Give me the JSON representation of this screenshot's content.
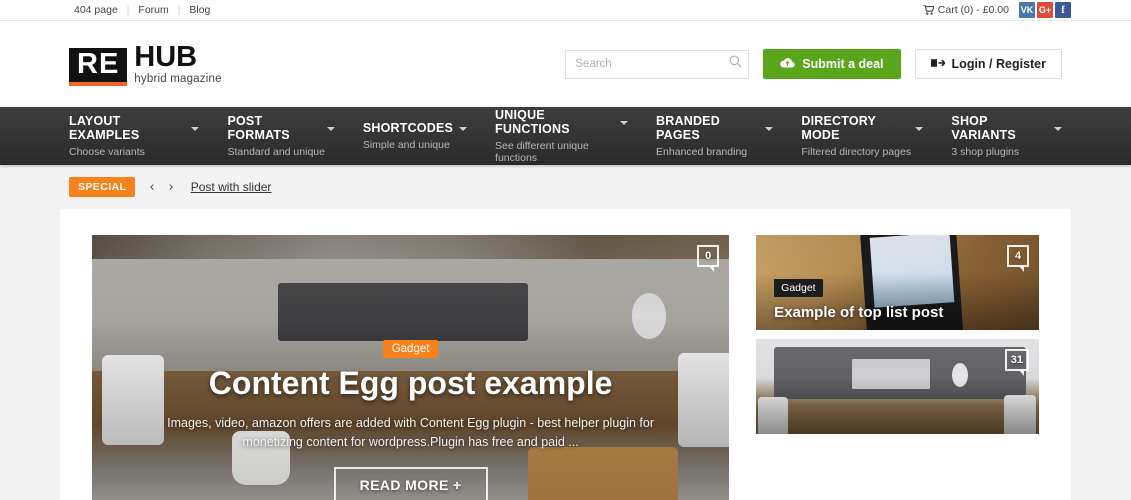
{
  "topbar": {
    "links": [
      {
        "label": "404 page"
      },
      {
        "label": "Forum"
      },
      {
        "label": "Blog"
      }
    ],
    "separator": "|",
    "cart_label": "Cart (0) - £0.00",
    "social": [
      {
        "name": "vk-icon",
        "label": "VK",
        "color": "#4a76a8"
      },
      {
        "name": "googleplus-icon",
        "label": "G+",
        "color": "#dd4b39"
      },
      {
        "name": "facebook-icon",
        "label": "f",
        "color": "#3b5998"
      }
    ]
  },
  "header": {
    "logo_mark": "RE",
    "logo_name": "HUB",
    "logo_tagline": "hybrid magazine",
    "logo_accent": "#f26522",
    "search_placeholder": "Search",
    "search_value": "",
    "submit_deal_label": "Submit a deal",
    "submit_deal_color": "#5aa61b",
    "login_label": "Login / Register"
  },
  "nav": {
    "items": [
      {
        "label": "LAYOUT EXAMPLES",
        "sub": "Choose variants"
      },
      {
        "label": "POST FORMATS",
        "sub": "Standard and unique"
      },
      {
        "label": "SHORTCODES",
        "sub": "Simple and unique"
      },
      {
        "label": "UNIQUE FUNCTIONS",
        "sub": "See different unique functions"
      },
      {
        "label": "BRANDED PAGES",
        "sub": "Enhanced branding"
      },
      {
        "label": "DIRECTORY MODE",
        "sub": "Filtered directory pages"
      },
      {
        "label": "SHOP VARIANTS",
        "sub": "3 shop plugins"
      }
    ]
  },
  "breadcrumb": {
    "badge": "SPECIAL",
    "badge_color": "#f7821b",
    "prev": "‹",
    "next": "›",
    "current": "Post with slider"
  },
  "featured": {
    "category": "Gadget",
    "category_color": "#f7821b",
    "title": "Content Egg post example",
    "excerpt": "Images, video, amazon offers are added with Content Egg plugin - best helper plugin for monetizing content for wordpress.Plugin has free and paid ...",
    "read_more": "READ MORE +",
    "comments": "0"
  },
  "sidecards": [
    {
      "category": "Gadget",
      "title": "Example of top list post",
      "comments": "4"
    },
    {
      "category": "",
      "title": "",
      "comments": "31"
    }
  ]
}
